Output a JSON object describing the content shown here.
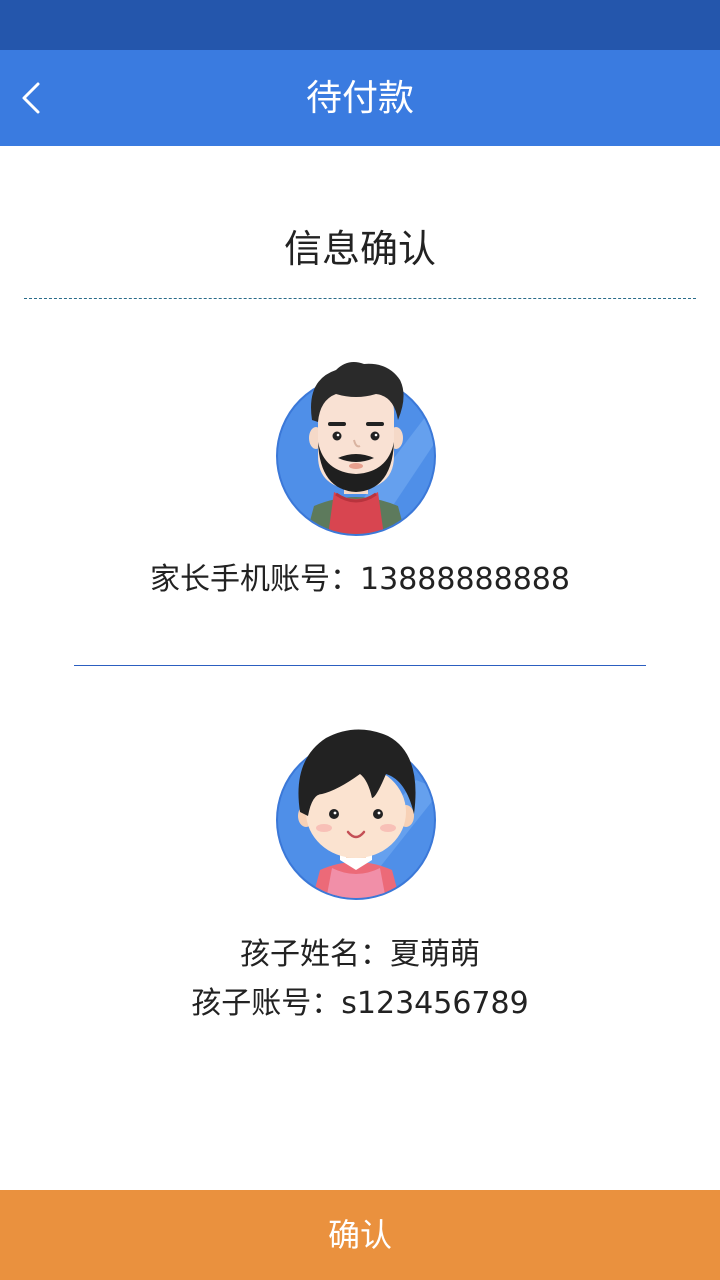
{
  "header": {
    "title": "待付款"
  },
  "section": {
    "title": "信息确认"
  },
  "parent": {
    "label": "家长手机账号：",
    "phone": "13888888888"
  },
  "child": {
    "name_label": "孩子姓名：",
    "name": "夏萌萌",
    "account_label": "孩子账号：",
    "account": "s123456789"
  },
  "footer": {
    "confirm_label": "确认"
  },
  "icons": {
    "back": "chevron-left-icon",
    "parent_avatar": "bearded-man-avatar",
    "child_avatar": "child-avatar"
  },
  "colors": {
    "status_bar": "#2456ac",
    "nav_bar": "#3a7be0",
    "confirm_button": "#ea913e",
    "divider": "#2c5fc0"
  }
}
